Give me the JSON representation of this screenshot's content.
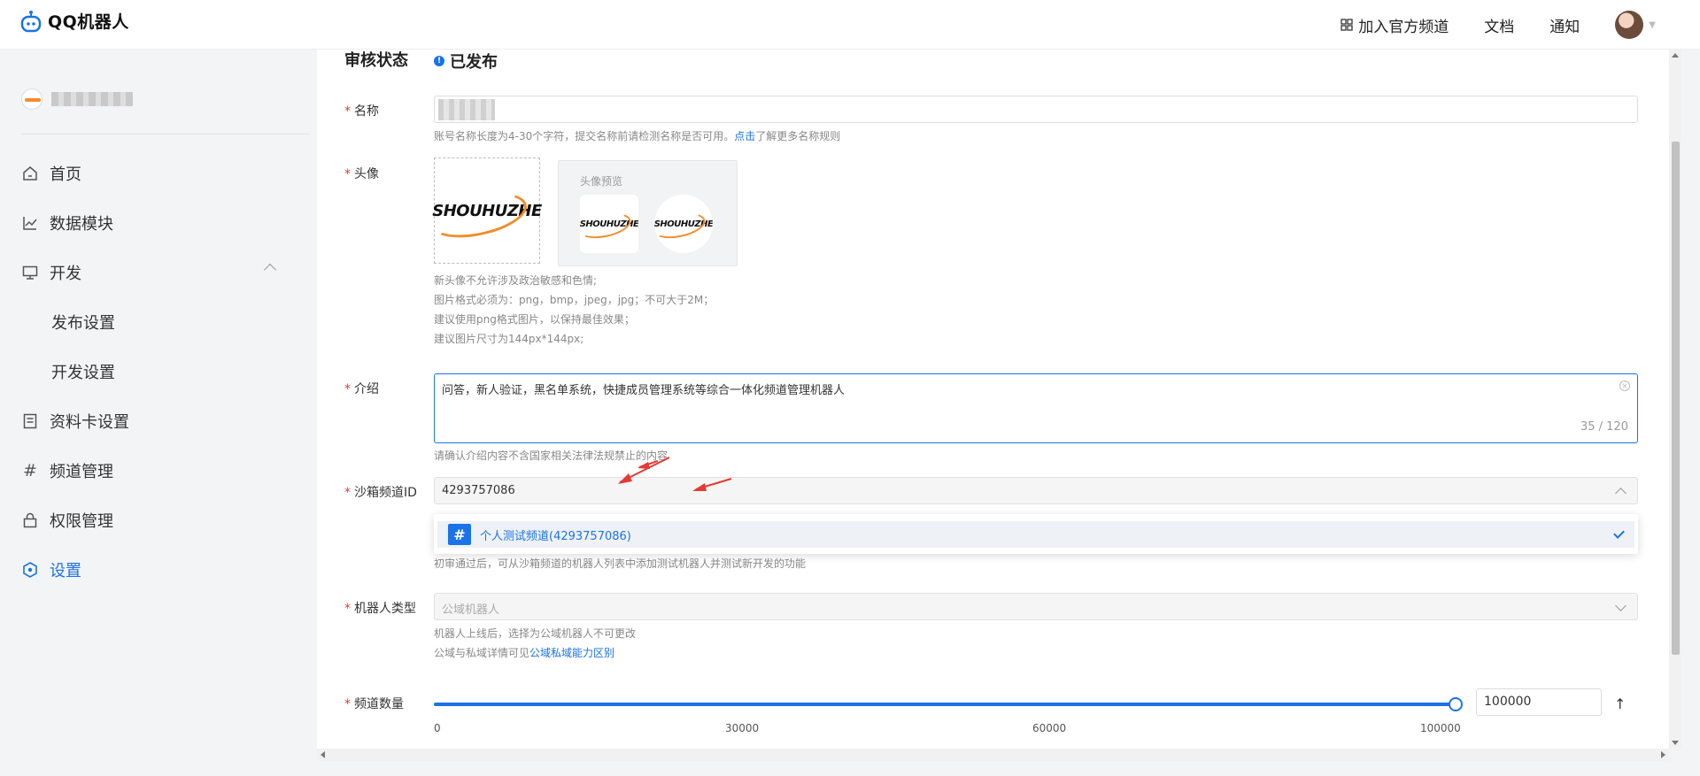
{
  "header": {
    "brand": "QQ机器人",
    "nav": [
      {
        "label": "加入官方频道"
      },
      {
        "label": "文档"
      },
      {
        "label": "通知"
      }
    ]
  },
  "sidebar": {
    "items": [
      {
        "label": "首页",
        "icon": "home-icon"
      },
      {
        "label": "数据模块",
        "icon": "chart-line-icon"
      },
      {
        "label": "开发",
        "icon": "monitor-icon"
      },
      {
        "label": "发布设置",
        "icon": ""
      },
      {
        "label": "开发设置",
        "icon": ""
      },
      {
        "label": "资料卡设置",
        "icon": "card-icon"
      },
      {
        "label": "频道管理",
        "icon": "hash-icon"
      },
      {
        "label": "权限管理",
        "icon": "lock-icon"
      },
      {
        "label": "设置",
        "icon": "settings-hex-icon"
      }
    ]
  },
  "form": {
    "status": {
      "label": "审核状态",
      "value": "已发布"
    },
    "name": {
      "label": "名称",
      "hint_prefix": "账号名称长度为4-30个字符，提交名称前请检测名称是否可用。",
      "hint_link": "点击",
      "hint_suffix": "了解更多名称规则"
    },
    "avatar": {
      "label": "头像",
      "preview_label": "头像预览",
      "logo_text": "SHOUHUZHE",
      "hints": [
        "新头像不允许涉及政治敏感和色情;",
        "图片格式必须为：png，bmp，jpeg，jpg；不可大于2M；",
        "建议使用png格式图片，以保持最佳效果；",
        "建议图片尺寸为144px*144px;"
      ]
    },
    "intro": {
      "label": "介绍",
      "value": "问答，新人验证，黑名单系统，快捷成员管理系统等综合一体化频道管理机器人",
      "counter": "35 / 120",
      "hint": "请确认介绍内容不含国家相关法律法规禁止的内容"
    },
    "sandbox": {
      "label": "沙箱频道ID",
      "value": "4293757086",
      "option": "个人测试频道(4293757086)",
      "hint": "初审通过后，可从沙箱频道的机器人列表中添加测试机器人并测试新开发的功能"
    },
    "bot_type": {
      "label": "机器人类型",
      "placeholder": "公域机器人",
      "hint1": "机器人上线后，选择为公域机器人不可更改",
      "hint2_prefix": "公域与私域详情可见",
      "hint2_link": "公域私域能力区别"
    },
    "channel_count": {
      "label": "频道数量",
      "value": "100000",
      "slider_fraction": 1.0,
      "ticks": [
        "0",
        "30000",
        "60000",
        "100000"
      ]
    }
  },
  "colors": {
    "accent": "#1a73e8",
    "required": "#e53935",
    "arrow": "#e53935"
  }
}
